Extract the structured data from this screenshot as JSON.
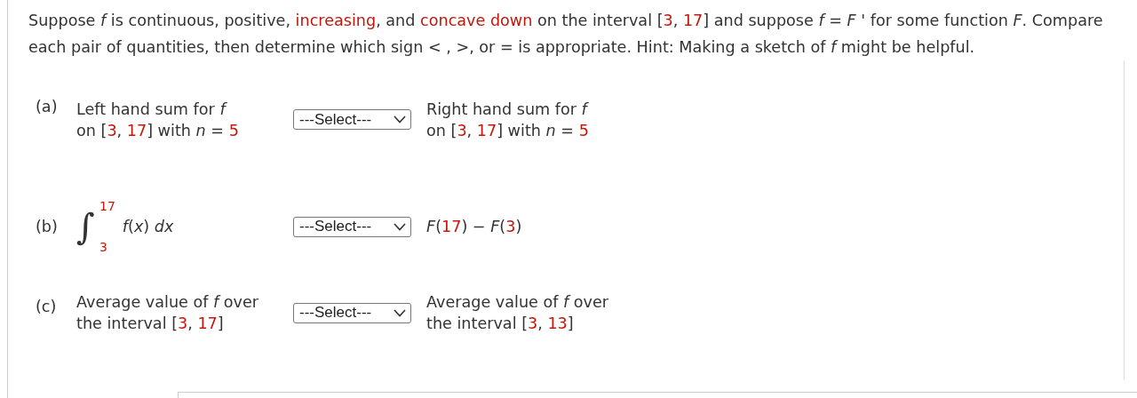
{
  "question": {
    "segments": [
      {
        "kind": "plain",
        "text": "Suppose *f* is continuous, positive, "
      },
      {
        "kind": "red",
        "text": "increasing"
      },
      {
        "kind": "plain",
        "text": ", and "
      },
      {
        "kind": "red",
        "text": "concave down"
      },
      {
        "kind": "plain",
        "text": " on the interval ["
      },
      {
        "kind": "red",
        "text": "3"
      },
      {
        "kind": "plain",
        "text": ", "
      },
      {
        "kind": "red",
        "text": "17"
      },
      {
        "kind": "plain",
        "text": "] and suppose *f* = *F* ' for some function *F*. Compare each pair of quantities, then determine which sign < , >, or = is appropriate. Hint: Making a sketch of *f* might be helpful."
      }
    ]
  },
  "parts": [
    {
      "label": "(a)",
      "kind": "text",
      "left": [
        [
          {
            "kind": "plain",
            "text": "Left hand sum for *f*"
          }
        ],
        [
          {
            "kind": "plain",
            "text": "on ["
          },
          {
            "kind": "red",
            "text": "3"
          },
          {
            "kind": "plain",
            "text": ", "
          },
          {
            "kind": "red",
            "text": "17"
          },
          {
            "kind": "plain",
            "text": "] with *n* = "
          },
          {
            "kind": "red",
            "text": "5"
          }
        ]
      ],
      "select": "---Select---",
      "right": [
        [
          {
            "kind": "plain",
            "text": "Right hand sum for *f*"
          }
        ],
        [
          {
            "kind": "plain",
            "text": "on ["
          },
          {
            "kind": "red",
            "text": "3"
          },
          {
            "kind": "plain",
            "text": ", "
          },
          {
            "kind": "red",
            "text": "17"
          },
          {
            "kind": "plain",
            "text": "] with *n* = "
          },
          {
            "kind": "red",
            "text": "5"
          }
        ]
      ]
    },
    {
      "label": "(b)",
      "kind": "integral",
      "integral": {
        "symbol": "∫",
        "upper": "17",
        "lower": "3",
        "integrand": "*f*(*x*) *dx*"
      },
      "select": "---Select---",
      "right": [
        [
          {
            "kind": "plain",
            "text": "*F*("
          },
          {
            "kind": "red",
            "text": "17"
          },
          {
            "kind": "plain",
            "text": ") − *F*("
          },
          {
            "kind": "red",
            "text": "3"
          },
          {
            "kind": "plain",
            "text": ")"
          }
        ]
      ]
    },
    {
      "label": "(c)",
      "kind": "text",
      "left": [
        [
          {
            "kind": "plain",
            "text": "Average value of *f* over"
          }
        ],
        [
          {
            "kind": "plain",
            "text": "the interval ["
          },
          {
            "kind": "red",
            "text": "3"
          },
          {
            "kind": "plain",
            "text": ", "
          },
          {
            "kind": "red",
            "text": "17"
          },
          {
            "kind": "plain",
            "text": "]"
          }
        ]
      ],
      "select": "---Select---",
      "right": [
        [
          {
            "kind": "plain",
            "text": "Average value of *f* over"
          }
        ],
        [
          {
            "kind": "plain",
            "text": "the interval ["
          },
          {
            "kind": "red",
            "text": "3"
          },
          {
            "kind": "plain",
            "text": ", "
          },
          {
            "kind": "red",
            "text": "13"
          },
          {
            "kind": "plain",
            "text": "]"
          }
        ]
      ]
    }
  ]
}
